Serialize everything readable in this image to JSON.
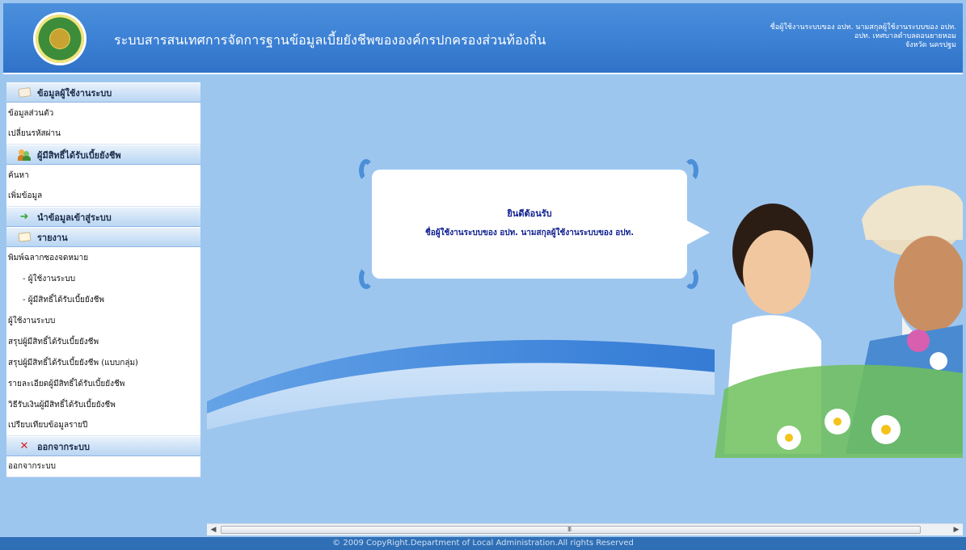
{
  "header": {
    "title": "ระบบสารสนเทศการจัดการฐานข้อมูลเบี้ยยังชีพขององค์กรปกครองส่วนท้องถิ่น",
    "user_lines": [
      "ชื่อผู้ใช้งานระบบของ อปท. นามสกุลผู้ใช้งานระบบของ อปท.",
      "อปท. เทศบาลตำบลดอนยายหอม",
      "จังหวัด นครปฐม"
    ]
  },
  "sidebar": {
    "sections": [
      {
        "label": "ข้อมูลผู้ใช้งานระบบ",
        "icon": "note-icon",
        "items": [
          "ข้อมูลส่วนตัว",
          "เปลี่ยนรหัสผ่าน"
        ]
      },
      {
        "label": "ผู้มีสิทธิ์ได้รับเบี้ยยังชีพ",
        "icon": "people-icon",
        "items": [
          "ค้นหา",
          "เพิ่มข้อมูล"
        ]
      },
      {
        "label": "นำข้อมูลเข้าสู่ระบบ",
        "icon": "import-arrow-icon",
        "items": []
      },
      {
        "label": "รายงาน",
        "icon": "report-icon",
        "items": [
          "พิมพ์ฉลากซองจดหมาย",
          "- ผู้ใช้งานระบบ",
          "- ผู้มีสิทธิ์ได้รับเบี้ยยังชีพ",
          "ผู้ใช้งานระบบ",
          "สรุปผู้มีสิทธิ์ได้รับเบี้ยยังชีพ",
          "สรุปผู้มีสิทธิ์ได้รับเบี้ยยังชีพ (แบบกลุ่ม)",
          "รายละเอียดผู้มีสิทธิ์ได้รับเบี้ยยังชีพ",
          "วิธีรับเงินผู้มีสิทธิ์ได้รับเบี้ยยังชีพ",
          "เปรียบเทียบข้อมูลรายปี"
        ]
      },
      {
        "label": "ออกจากระบบ",
        "icon": "exit-x-icon",
        "items": [
          "ออกจากระบบ"
        ]
      }
    ]
  },
  "welcome": {
    "title": "ยินดีต้อนรับ",
    "subtitle": "ชื่อผู้ใช้งานระบบของ อปท. นามสกุลผู้ใช้งานระบบของ อปท."
  },
  "scrollbar": {
    "grip": "III"
  },
  "footer": {
    "copyright": "© 2009 CopyRight.Department of Local Administration.All rights Reserved"
  },
  "colors": {
    "page_background": "#9dc6ef",
    "header_blue": "#3a7fd3",
    "footer_blue": "#2f6fb6",
    "welcome_text": "#10208f"
  }
}
